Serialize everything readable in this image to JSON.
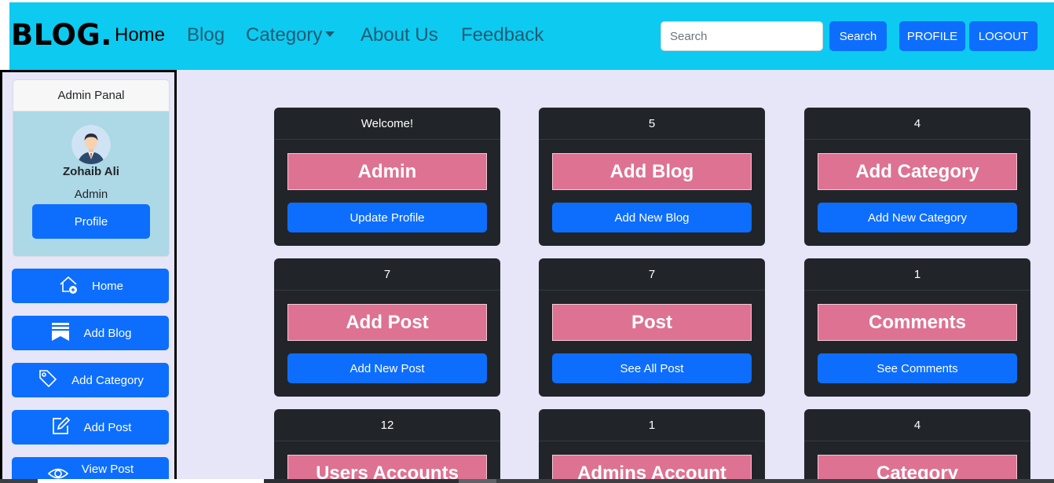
{
  "nav": {
    "brand": "BLOG.",
    "links": [
      "Home",
      "Blog",
      "Category",
      "About Us",
      "Feedback"
    ],
    "search_placeholder": "Search",
    "search_button": "Search",
    "profile_button": "PROFILE",
    "logout_button": "LOGOUT"
  },
  "sidebar": {
    "panel_title": "Admin Panal",
    "user_name": "Zohaib Ali",
    "user_role": "Admin",
    "profile_button": "Profile",
    "items": [
      {
        "label": "Home",
        "icon": "home-add-icon"
      },
      {
        "label": "Add Blog",
        "icon": "bookmark-icon"
      },
      {
        "label": "Add Category",
        "icon": "tag-icon"
      },
      {
        "label": "Add Post",
        "icon": "edit-icon"
      },
      {
        "label": "View Post",
        "icon": "eye-icon"
      }
    ]
  },
  "cards": [
    {
      "header": "Welcome!",
      "title": "Admin",
      "button": "Update Profile"
    },
    {
      "header": "5",
      "title": "Add Blog",
      "button": "Add New Blog"
    },
    {
      "header": "4",
      "title": "Add Category",
      "button": "Add New Category"
    },
    {
      "header": "7",
      "title": "Add Post",
      "button": "Add New Post"
    },
    {
      "header": "7",
      "title": "Post",
      "button": "See All Post"
    },
    {
      "header": "1",
      "title": "Comments",
      "button": "See Comments"
    },
    {
      "header": "12",
      "title": "Users Accounts",
      "button": ""
    },
    {
      "header": "1",
      "title": "Admins Account",
      "button": ""
    },
    {
      "header": "4",
      "title": "Category",
      "button": ""
    }
  ],
  "colors": {
    "navbar": "#0dcaf0",
    "primary": "#0d6efd",
    "card_bg": "#212529",
    "card_title": "#de7292",
    "page_bg": "#e6e6f8",
    "profile_bg": "#add8e6"
  }
}
